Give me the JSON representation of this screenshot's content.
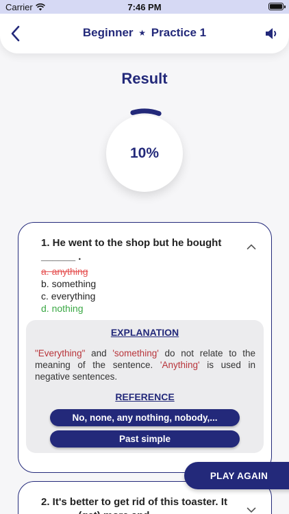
{
  "status_bar": {
    "carrier": "Carrier",
    "time": "7:46 PM"
  },
  "header": {
    "title_level": "Beginner",
    "title_star": "★",
    "title_practice": "Practice 1",
    "back_icon": "chevron-left-icon",
    "speaker_icon": "speaker-icon"
  },
  "result": {
    "title": "Result",
    "score_label": "10%",
    "score_fraction": 0.1
  },
  "question1": {
    "text": "1. He went to the shop but he bought ______ .",
    "options": [
      {
        "label": "a. anything",
        "state": "wrong"
      },
      {
        "label": "b. something",
        "state": "normal"
      },
      {
        "label": "c. everything",
        "state": "normal"
      },
      {
        "label": "d. nothing",
        "state": "correct"
      }
    ],
    "explanation_title": "EXPLANATION",
    "explanation_parts": {
      "p1": "\"Everything\"",
      "p2": " and ",
      "p3": "'something'",
      "p4": " do not relate to the meaning of the sentence. ",
      "p5": "'Anything'",
      "p6": " is used in negative sentences."
    },
    "reference_title": "REFERENCE",
    "references": [
      "No, none, any nothing, nobody,...",
      "Past simple"
    ]
  },
  "question2": {
    "text": "2. It's better to get rid of this toaster. It ______ (get) more and"
  },
  "play_again": "PLAY AGAIN",
  "colors": {
    "primary": "#23297a",
    "wrong": "#e55050",
    "correct": "#3aa844",
    "highlight": "#b8343a",
    "status_bg": "#d6d9f4"
  }
}
